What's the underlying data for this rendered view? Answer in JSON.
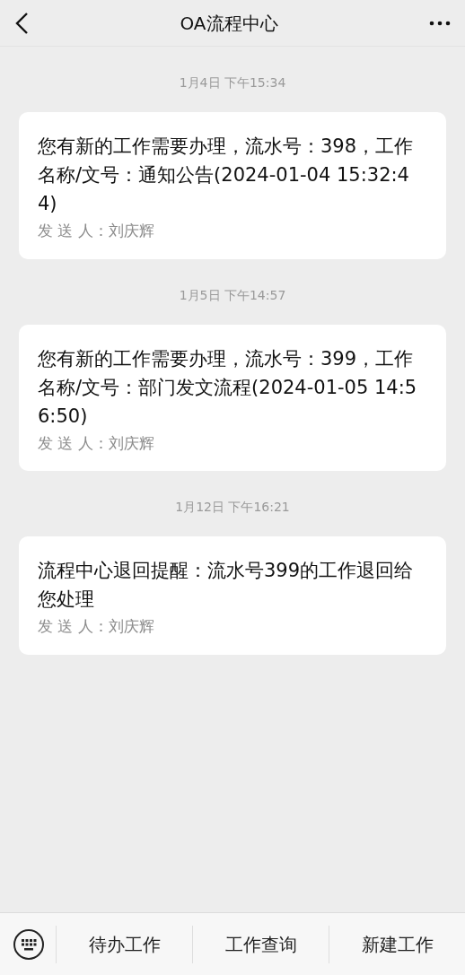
{
  "header": {
    "title": "OA流程中心"
  },
  "messages": [
    {
      "time": "1月4日 下午15:34",
      "text": "您有新的工作需要办理，流水号：398，工作名称/文号：通知公告(2024-01-04 15:32:44)",
      "sender": "发 送 人：刘庆辉"
    },
    {
      "time": "1月5日 下午14:57",
      "text": "您有新的工作需要办理，流水号：399，工作名称/文号：部门发文流程(2024-01-05 14:56:50)",
      "sender": "发 送 人：刘庆辉"
    },
    {
      "time": "1月12日 下午16:21",
      "text": "流程中心退回提醒：流水号399的工作退回给您处理",
      "sender": "发 送 人：刘庆辉"
    }
  ],
  "menu": [
    "待办工作",
    "工作查询",
    "新建工作"
  ]
}
